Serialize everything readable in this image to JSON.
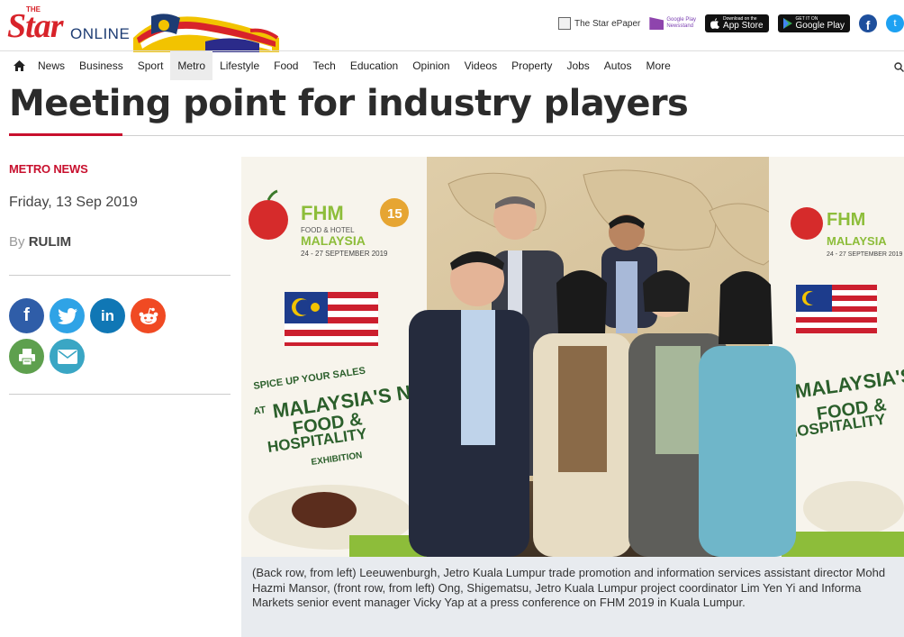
{
  "header": {
    "logo_small": "THE",
    "logo_main": "Star",
    "logo_online": "ONLINE",
    "epaper_label": "The Star ePaper",
    "google_news_line1": "Google Play",
    "google_news_line2": "Newsstand",
    "app_store_small": "Download on the",
    "app_store_label": "App Store",
    "google_play_small": "GET IT ON",
    "google_play_label": "Google Play",
    "facebook_glyph": "f",
    "twitter_glyph": "t"
  },
  "nav": {
    "items": [
      "News",
      "Business",
      "Sport",
      "Metro",
      "Lifestyle",
      "Food",
      "Tech",
      "Education",
      "Opinion",
      "Videos",
      "Property",
      "Jobs",
      "Autos",
      "More"
    ],
    "active": "Metro"
  },
  "article": {
    "title": "Meeting point for industry players",
    "section": "METRO NEWS",
    "date": "Friday, 13 Sep 2019",
    "by_prefix": "By",
    "author": "RULIM",
    "caption": "(Back row, from left) Leeuwenburgh, Jetro Kuala Lumpur trade promotion and information services assistant director Mohd Hazmi Mansor, (front row, from left) Ong, Shigematsu, Jetro Kuala Lumpur project coordinator Lim Yen Yi and Informa Markets senior event manager Vicky Yap at a press conference on FHM 2019 in Kuala Lumpur."
  },
  "banner": {
    "fhm": "FHM",
    "fhm_sub": "FOOD & HOTEL",
    "country": "MALAYSIA",
    "dates": "24 - 27 SEPTEMBER 2019",
    "anniv": "15",
    "spice": "SPICE UP YOUR SALES",
    "at": "AT",
    "malaysias": "MALAYSIA'S No.1",
    "food": "FOOD &",
    "hosp": "HOSPITALITY",
    "exhib": "EXHIBITION"
  },
  "share": {
    "facebook": "f",
    "twitter": "t",
    "linkedin": "in",
    "reddit": "r",
    "print": "P",
    "email": "@"
  },
  "colors": {
    "brand_red": "#c8102e",
    "brand_blue": "#1d3c73",
    "caption_bg": "#e8ebef"
  }
}
